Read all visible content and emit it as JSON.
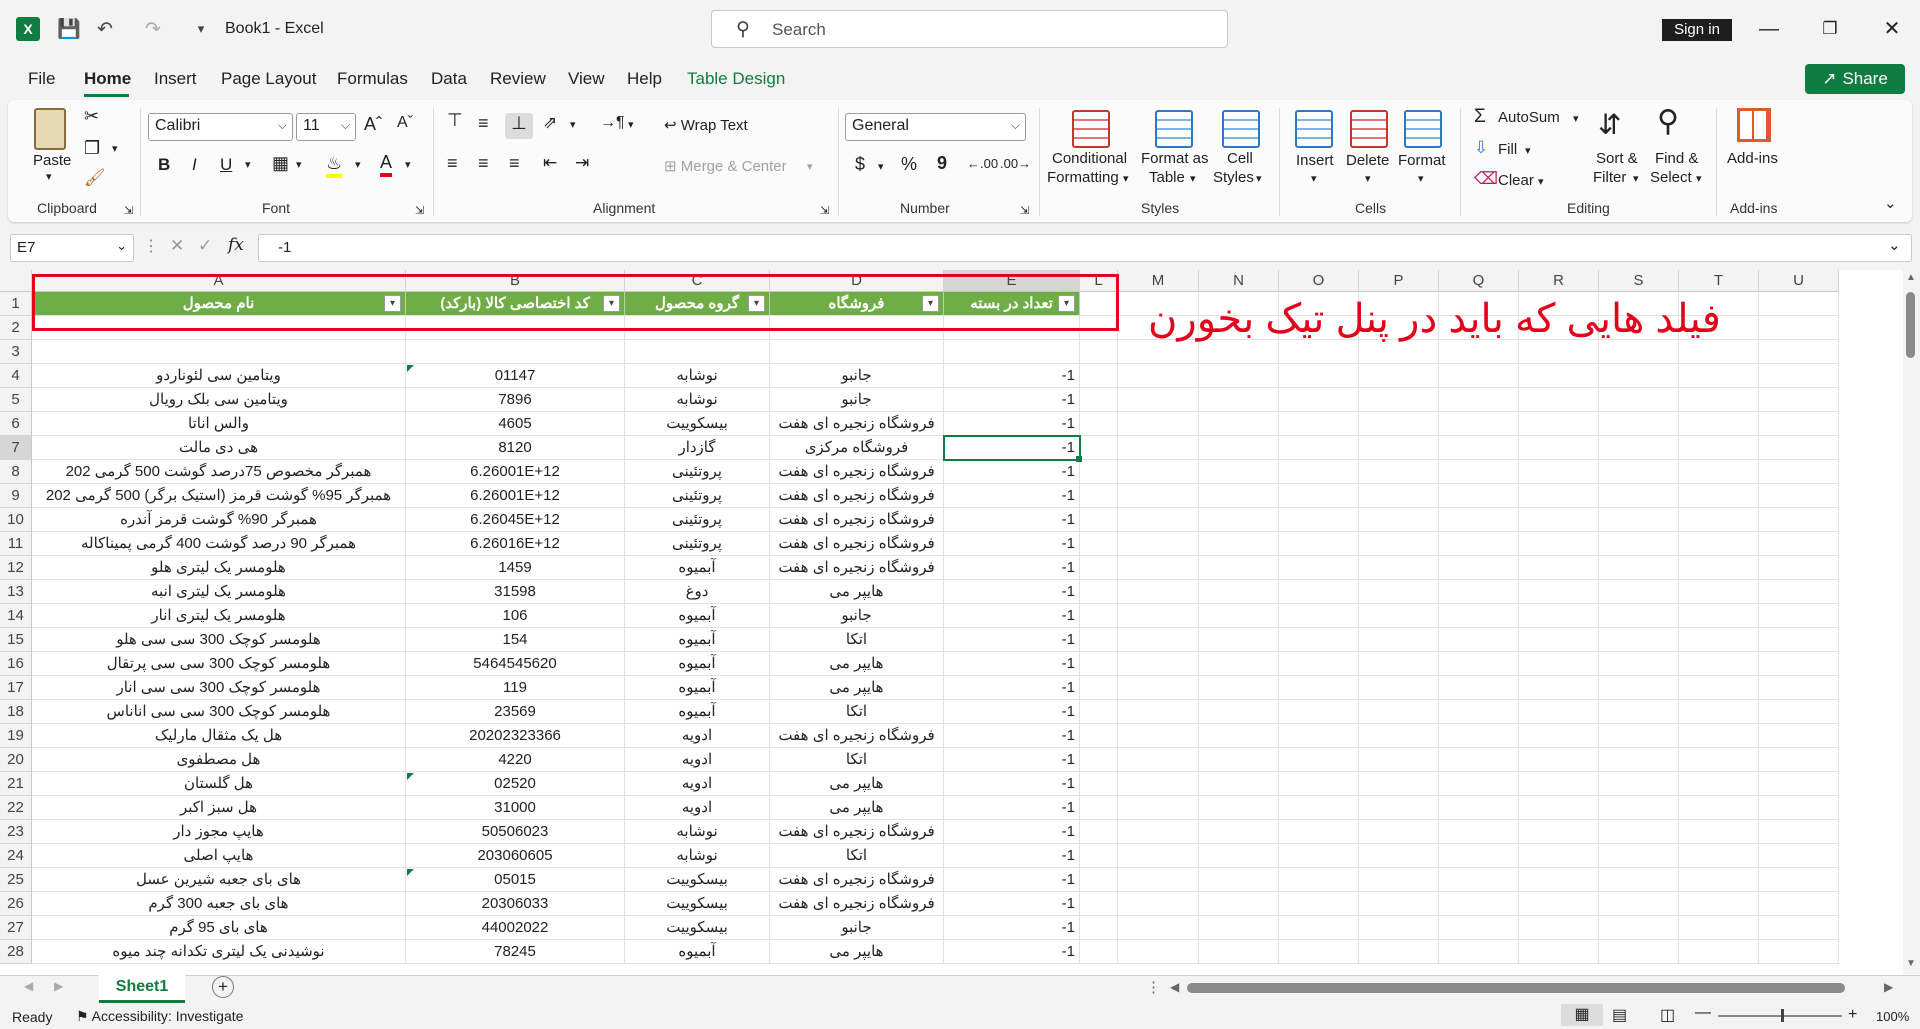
{
  "app": {
    "doc_title": "Book1  -  Excel",
    "search_placeholder": "Search",
    "sign_in": "Sign in",
    "share": "Share"
  },
  "tabs": [
    "File",
    "Home",
    "Insert",
    "Page Layout",
    "Formulas",
    "Data",
    "Review",
    "View",
    "Help",
    "Table Design"
  ],
  "ribbon": {
    "clipboard": {
      "paste": "Paste",
      "label": "Clipboard"
    },
    "font": {
      "name": "Calibri",
      "size": "11",
      "label": "Font",
      "bold": "B",
      "italic": "I",
      "underline": "U"
    },
    "alignment": {
      "wrap": "Wrap Text",
      "merge": "Merge & Center",
      "label": "Alignment"
    },
    "number": {
      "format": "General",
      "label": "Number",
      "currency": "$",
      "percent": "%",
      "comma": "9"
    },
    "styles": {
      "cond1": "Conditional",
      "cond2": "Formatting",
      "fmt1": "Format as",
      "fmt2": "Table",
      "cell1": "Cell",
      "cell2": "Styles",
      "label": "Styles"
    },
    "cells": {
      "insert": "Insert",
      "delete": "Delete",
      "format": "Format",
      "label": "Cells"
    },
    "editing": {
      "autosum": "AutoSum",
      "fill": "Fill",
      "clear": "Clear",
      "sort1": "Sort &",
      "sort2": "Filter",
      "find1": "Find &",
      "find2": "Select",
      "label": "Editing"
    },
    "addins": {
      "btn": "Add-ins",
      "label": "Add-ins"
    }
  },
  "formula_bar": {
    "name_box": "E7",
    "fx": "fx",
    "value": "-1"
  },
  "columns": [
    "A",
    "B",
    "C",
    "D",
    "E",
    "L",
    "M",
    "N",
    "O",
    "P",
    "Q",
    "R",
    "S",
    "T",
    "U"
  ],
  "table_headers": [
    "نام محصول",
    "کد اختصاصی کالا (بارکد)",
    "گروه محصول",
    "فروشگاه",
    "تعداد در بسته"
  ],
  "row_numbers": [
    "1",
    "2",
    "3",
    "4",
    "5",
    "6",
    "7",
    "8",
    "9",
    "10",
    "11",
    "12",
    "13",
    "14",
    "15",
    "16",
    "17",
    "18",
    "19",
    "20",
    "21",
    "22",
    "23",
    "24",
    "25",
    "26",
    "27",
    "28"
  ],
  "rows": [
    [
      "ویتامین سی لئوناردو",
      "01147",
      "نوشابه",
      "جانبو",
      "-1"
    ],
    [
      "ویتامین سی بلک رویال",
      "7896",
      "نوشابه",
      "جانبو",
      "-1"
    ],
    [
      "والس اناتا",
      "4605",
      "بیسکوییت",
      "فروشگاه زنجیره ای هفت",
      "-1"
    ],
    [
      "هی دی مالت",
      "8120",
      "گازدار",
      "فروشگاه مرکزی",
      "-1"
    ],
    [
      "همبرگر مخصوص 75درصد گوشت 500 گرمی 202",
      "6.26001E+12",
      "پروتئینی",
      "فروشگاه زنجیره ای هفت",
      "-1"
    ],
    [
      "همبرگر 95% گوشت قرمز (استیک برگر) 500 گرمی 202",
      "6.26001E+12",
      "پروتئینی",
      "فروشگاه زنجیره ای هفت",
      "-1"
    ],
    [
      "همبرگر 90% گوشت قرمز آندره",
      "6.26045E+12",
      "پروتئینی",
      "فروشگاه زنجیره ای هفت",
      "-1"
    ],
    [
      "همبرگر 90 درصد گوشت 400 گرمی پمیناکاله",
      "6.26016E+12",
      "پروتئینی",
      "فروشگاه زنجیره ای هفت",
      "-1"
    ],
    [
      "هلومسر یک لیتری هلو",
      "1459",
      "آبمیوه",
      "فروشگاه زنجیره ای هفت",
      "-1"
    ],
    [
      "هلومسر یک لیتری انبه",
      "31598",
      "دوغ",
      "هایپر می",
      "-1"
    ],
    [
      "هلومسر یک لیتری انار",
      "106",
      "آبمیوه",
      "جانبو",
      "-1"
    ],
    [
      "هلومسر کوچک 300 سی سی هلو",
      "154",
      "آبمیوه",
      "اتکا",
      "-1"
    ],
    [
      "هلومسر کوچک 300 سی سی پرتقال",
      "5464545620",
      "آبمیوه",
      "هایپر می",
      "-1"
    ],
    [
      "هلومسر کوچک 300 سی سی انار",
      "119",
      "آبمیوه",
      "هایپر می",
      "-1"
    ],
    [
      "هلومسر کوچک  300 سی سی اناناس",
      "23569",
      "آبمیوه",
      "اتکا",
      "-1"
    ],
    [
      "هل یک مثقال مارلیک",
      "20202323366",
      "ادویه",
      "فروشگاه زنجیره ای هفت",
      "-1"
    ],
    [
      "هل مصطفوی",
      "4220",
      "ادویه",
      "اتکا",
      "-1"
    ],
    [
      "هل گلستان",
      "02520",
      "ادویه",
      "هایپر می",
      "-1"
    ],
    [
      "هل سبز اکبر",
      "31000",
      "ادویه",
      "هایپر می",
      "-1"
    ],
    [
      "هایپ مجوز دار",
      "50506023",
      "نوشابه",
      "فروشگاه زنجیره ای هفت",
      "-1"
    ],
    [
      "هایپ اصلی",
      "203060605",
      "نوشابه",
      "اتکا",
      "-1"
    ],
    [
      "های بای جعبه شیرین عسل",
      "05015",
      "بیسکوییت",
      "فروشگاه زنجیره ای هفت",
      "-1"
    ],
    [
      "های بای جعبه 300 گرم",
      "20306033",
      "بیسکوییت",
      "فروشگاه زنجیره ای هفت",
      "-1"
    ],
    [
      "های بای 95 گرم",
      "44002022",
      "بیسکوییت",
      "جانبو",
      "-1"
    ],
    [
      "نوشیدنی یک لیتری تکدانه چند میوه",
      "78245",
      "آبمیوه",
      "هایپر می",
      "-1"
    ]
  ],
  "annotation": "فیلد هایی که باید در پنل تیک بخورن",
  "sheet_tab": "Sheet1",
  "status": {
    "ready": "Ready",
    "accessibility": "Accessibility: Investigate",
    "zoom": "100%"
  },
  "colors": {
    "accent": "#107c41",
    "table_header": "#70ad47",
    "annotation": "#e3001b"
  }
}
